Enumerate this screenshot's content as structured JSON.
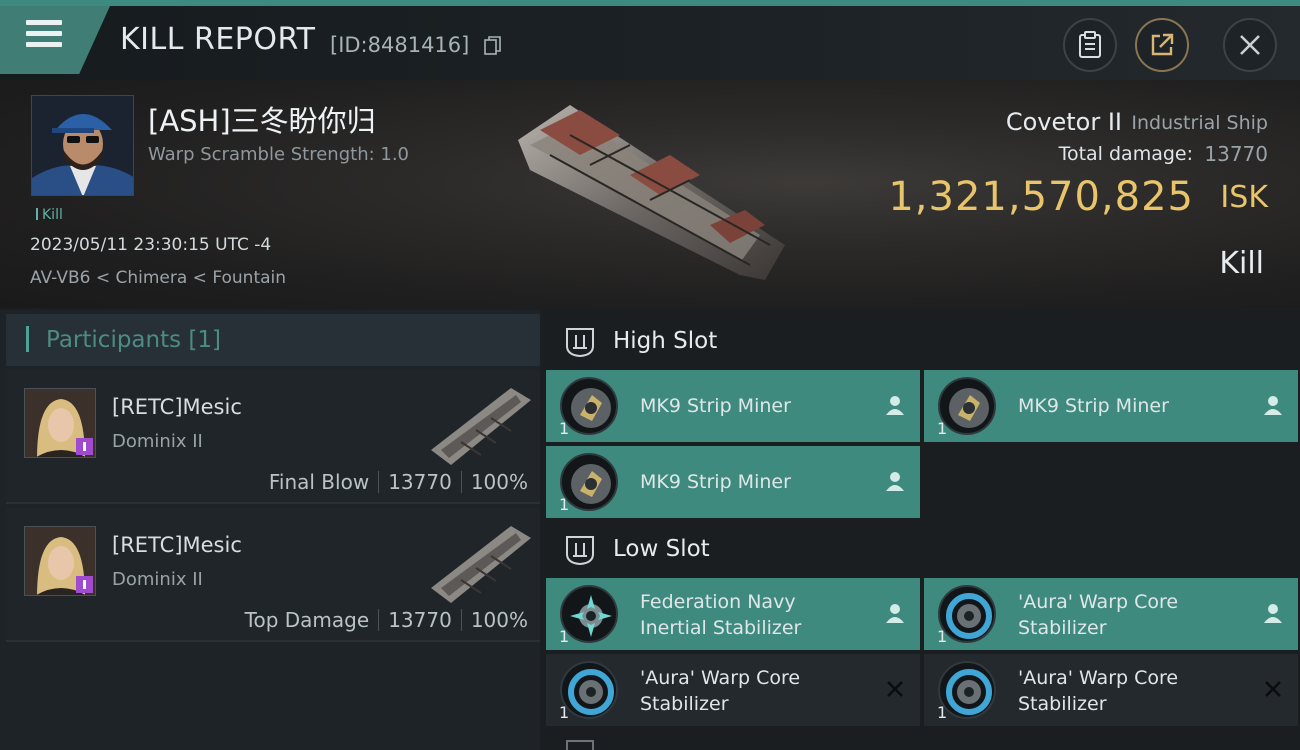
{
  "header": {
    "title": "KILL REPORT",
    "report_id": "[ID:8481416]",
    "buttons": [
      "clipboard-icon",
      "share-icon",
      "close-icon"
    ]
  },
  "victim": {
    "name": "[ASH]三冬盼你归",
    "warp_scramble": "Warp Scramble Strength: 1.0",
    "tag": "Kill",
    "datetime": "2023/05/11 23:30:15 UTC -4",
    "location": "AV-VB6 < Chimera < Fountain"
  },
  "ship": {
    "name": "Covetor II",
    "class": "Industrial Ship",
    "total_damage_label": "Total damage:",
    "total_damage": "13770",
    "isk_value": "1,321,570,825",
    "isk_unit": "ISK",
    "result": "Kill"
  },
  "participants": {
    "title": "Participants [1]",
    "items": [
      {
        "name": "[RETC]Mesic",
        "ship": "Dominix II",
        "role": "Final Blow",
        "damage": "13770",
        "percent": "100%"
      },
      {
        "name": "[RETC]Mesic",
        "ship": "Dominix II",
        "role": "Top Damage",
        "damage": "13770",
        "percent": "100%"
      }
    ]
  },
  "fitting": {
    "high_slot": {
      "title": "High Slot",
      "modules": [
        {
          "name": "MK9 Strip Miner",
          "qty": "1",
          "state": "dropped"
        },
        {
          "name": "MK9 Strip Miner",
          "qty": "1",
          "state": "dropped"
        },
        {
          "name": "MK9 Strip Miner",
          "qty": "1",
          "state": "dropped"
        }
      ]
    },
    "low_slot": {
      "title": "Low Slot",
      "modules": [
        {
          "name_line1": "Federation Navy",
          "name_line2": "Inertial Stabilizer",
          "qty": "1",
          "state": "dropped"
        },
        {
          "name_line1": "'Aura' Warp Core",
          "name_line2": "Stabilizer",
          "qty": "1",
          "state": "dropped"
        },
        {
          "name_line1": "'Aura' Warp Core",
          "name_line2": "Stabilizer",
          "qty": "1",
          "state": "destroyed"
        },
        {
          "name_line1": "'Aura' Warp Core",
          "name_line2": "Stabilizer",
          "qty": "1",
          "state": "destroyed"
        }
      ]
    }
  },
  "colors": {
    "accent_teal": "#3f8a7f",
    "isk_gold": "#e8c46a",
    "background": "#1b1f22"
  }
}
